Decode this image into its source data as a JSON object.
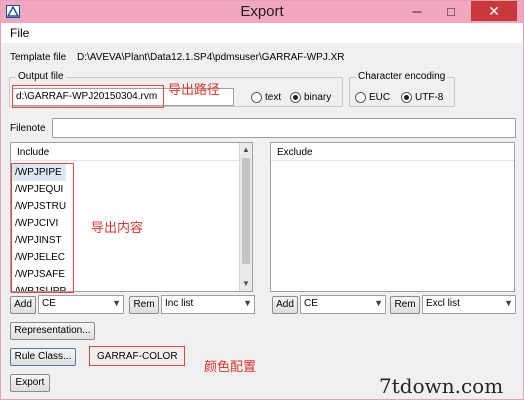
{
  "window": {
    "title": "Export",
    "controls": {
      "minimize": "─",
      "maximize": "□",
      "close": "✕"
    }
  },
  "menu": {
    "file": "File"
  },
  "template_file": {
    "label": "Template file",
    "path": "D:\\AVEVA\\Plant\\Data12.1.SP4\\pdmsuser\\GARRAF-WPJ.XR"
  },
  "output_file": {
    "group_label": "Output file",
    "value": "d:\\GARRAF-WPJ20150304.rvm",
    "format_options": [
      {
        "label": "text",
        "selected": false
      },
      {
        "label": "binary",
        "selected": true
      }
    ],
    "annotation": "导出路径"
  },
  "character_encoding": {
    "group_label": "Character encoding",
    "options": [
      {
        "label": "EUC",
        "selected": false
      },
      {
        "label": "UTF-8",
        "selected": true
      }
    ]
  },
  "filenote": {
    "label": "Filenote",
    "value": ""
  },
  "include": {
    "header": "Include",
    "items": [
      "/WPJPIPE",
      "/WPJEQUI",
      "/WPJSTRU",
      "/WPJCIVI",
      "/WPJINST",
      "/WPJELEC",
      "/WPJSAFE",
      "/WPJSUPP"
    ],
    "annotation": "导出内容",
    "add_label": "Add",
    "ce_value": "CE",
    "rem_label": "Rem",
    "list_value": "Inc list"
  },
  "exclude": {
    "header": "Exclude",
    "add_label": "Add",
    "ce_value": "CE",
    "rem_label": "Rem",
    "list_value": "Excl list"
  },
  "representation_label": "Representation...",
  "rule_class": {
    "label": "Rule Class...",
    "value": "GARRAF-COLOR",
    "annotation": "颜色配置"
  },
  "export_label": "Export",
  "watermark": "7tdown.com",
  "colors": {
    "titlebar": "#f2a7c0",
    "close": "#c7393a",
    "annotation": "#e0342c"
  }
}
